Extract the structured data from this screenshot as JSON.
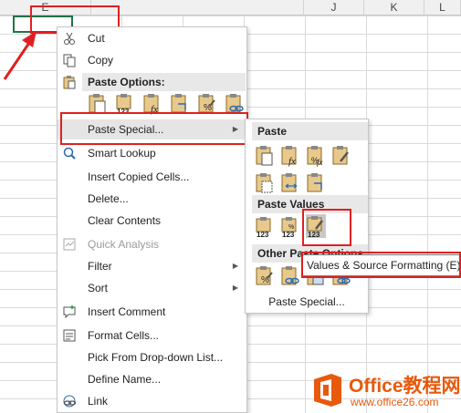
{
  "columns": [
    "E",
    "J",
    "K",
    "L"
  ],
  "context_menu": {
    "cut": "Cut",
    "copy": "Copy",
    "paste_options_header": "Paste Options:",
    "paste_special": "Paste Special...",
    "smart_lookup": "Smart Lookup",
    "insert_copied_cells": "Insert Copied Cells...",
    "delete": "Delete...",
    "clear_contents": "Clear Contents",
    "quick_analysis": "Quick Analysis",
    "filter": "Filter",
    "sort": "Sort",
    "insert_comment": "Insert Comment",
    "format_cells": "Format Cells...",
    "pick_from_list": "Pick From Drop-down List...",
    "define_name": "Define Name...",
    "link": "Link"
  },
  "submenu": {
    "paste_header": "Paste",
    "paste_values_header": "Paste Values",
    "other_header": "Other Paste Options",
    "paste_special_link": "Paste Special..."
  },
  "tooltip": "Values & Source Formatting (E)",
  "watermark": {
    "title": "Office教程网",
    "url": "www.office26.com"
  },
  "colors": {
    "annotation_red": "#e02020",
    "selection_green": "#217346",
    "watermark_orange": "#e8590c"
  }
}
